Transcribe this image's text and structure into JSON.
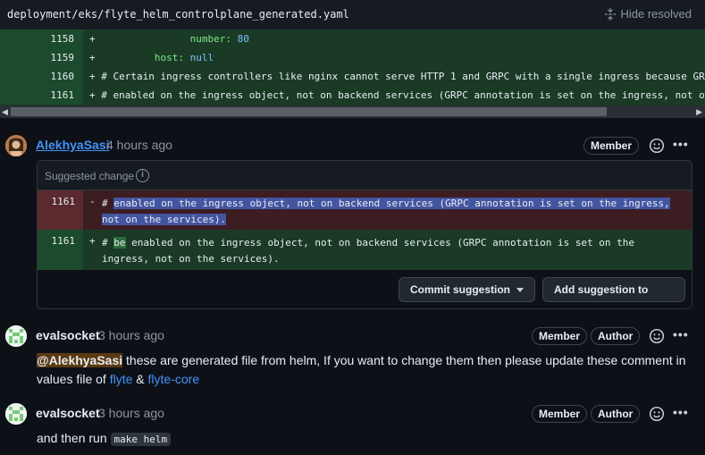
{
  "file": {
    "path": "deployment/eks/flyte_helm_controlplane_generated.yaml",
    "hide_resolved_label": "Hide resolved"
  },
  "diff": {
    "rows": [
      {
        "num": "1158",
        "sign": "+",
        "indent": "                ",
        "key": "number:",
        "value": " 80"
      },
      {
        "num": "1159",
        "sign": "+",
        "indent": "          ",
        "key": "host:",
        "value": " null"
      },
      {
        "num": "1160",
        "sign": "+",
        "text": " # Certain ingress controllers like nginx cannot serve HTTP 1 and GRPC with a single ingress because GRPC"
      },
      {
        "num": "1161",
        "sign": "+",
        "text": " # enabled on the ingress object, not on backend services (GRPC annotation is set on the ingress, not on"
      }
    ]
  },
  "comments": [
    {
      "user": "AlekhyaSasi",
      "time": "4 hours ago",
      "badges": [
        "Member"
      ],
      "suggestion": {
        "title": "Suggested change",
        "deleted": {
          "num": "1161",
          "sign": "-",
          "prefix": "# ",
          "highlight_line1": "enabled on the ingress object, not on backend services (GRPC annotation is set on the ingress,",
          "highlight_line2": "not on the services)."
        },
        "added": {
          "num": "1161",
          "sign": "+",
          "prefix": "# ",
          "highlight": "be",
          "line1_rest": " enabled on the ingress object, not on backend services (GRPC annotation is set on the",
          "line2": "ingress, not on the services)."
        },
        "commit_label": "Commit suggestion",
        "batch_label": "Add suggestion to batch"
      }
    },
    {
      "user": "evalsocket",
      "time": "3 hours ago",
      "badges": [
        "Member",
        "Author"
      ],
      "mention": "@AlekhyaSasi",
      "text1": " these are generated file from helm, If you want to change them then please update these comment in",
      "text2": "values file of ",
      "link1": "flyte",
      "amp": " & ",
      "link2": "flyte-core"
    },
    {
      "user": "evalsocket",
      "time": "3 hours ago",
      "badges": [
        "Member",
        "Author"
      ],
      "text": "and then run ",
      "code": "make helm"
    }
  ],
  "icons": {
    "hide_resolved": "unfold-icon",
    "info": "info-icon",
    "emoji": "smiley-icon",
    "more": "kebab-horizontal-icon",
    "caret": "triangle-down-icon"
  }
}
